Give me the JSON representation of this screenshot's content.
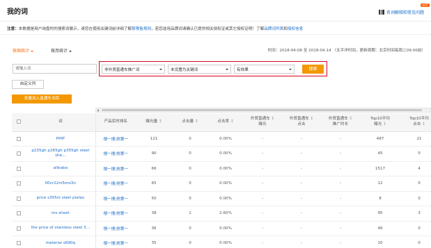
{
  "header": {
    "title": "我的词",
    "help_link": "名词解释和常见问题",
    "hot_badge": "HOT"
  },
  "notice": {
    "label": "注意：",
    "text_before": "本数据是用户询盘时的搜索词展示，请您在使用关键词前详细了解",
    "link_rules": "禁限售规则",
    "text_middle": "，若您选用品牌词请确认已提供相关授权证或其它授权证明！了解",
    "link_brand": "品牌词列表",
    "text_and": "和",
    "link_auth": "授权信息"
  },
  "tabs": {
    "weekly": "按周统计",
    "monthly": "按月统计"
  },
  "time_info": "时间：2018-04-08 至 2018-04-14 （太平洋时间，更新周期：北京时间每周二09:00前）",
  "filters": {
    "keyword_placeholder": "请输入词",
    "select1": "非外贸直通车推广词",
    "select2": "未设置为关键词",
    "select3": "有效果",
    "search_button": "搜索"
  },
  "buttons": {
    "custom_columns": "自定义列",
    "batch_add": "批量加入直通车词库"
  },
  "table": {
    "headers": {
      "keyword": "词",
      "rank": "产品实时排名",
      "impressions": "曝光量",
      "clicks": "点击量",
      "ctr": "点击率",
      "p4p_impressions_line1": "外贸直通车",
      "p4p_impressions_line2": "曝光",
      "p4p_clicks_line1": "外贸直通车",
      "p4p_clicks_line2": "点击",
      "p4p_time_line1": "外贸直通车",
      "p4p_time_line2": "推广时长",
      "top10_imp_line1": "Top10平均",
      "top10_imp_line2": "曝光",
      "top10_clk_line1": "Top10平均",
      "top10_clk_line2": "点击"
    },
    "sort_glyph": "↕",
    "rank_view": "搜一搜",
    "rank_divider": "|",
    "rank_first": "抢第一",
    "rows": [
      {
        "keyword": "ppgi",
        "impressions": "121",
        "clicks": "0",
        "ctr": "0.00%",
        "p4p_imp": "-",
        "p4p_clk": "-",
        "p4p_time": "-",
        "top10_imp": "487",
        "top10_clk": "21"
      },
      {
        "keyword": "p235gh p265gh p355gh steel she...",
        "impressions": "90",
        "clicks": "0",
        "ctr": "0.00%",
        "p4p_imp": "-",
        "p4p_clk": "-",
        "p4p_time": "-",
        "top10_imp": "45",
        "top10_clk": "0"
      },
      {
        "keyword": "alibaba",
        "impressions": "66",
        "clicks": "0",
        "ctr": "0.00%",
        "p4p_imp": "-",
        "p4p_clk": "-",
        "p4p_time": "-",
        "top10_imp": "1517",
        "top10_clk": "4"
      },
      {
        "keyword": "00cr22ni5mo3n",
        "impressions": "65",
        "clicks": "0",
        "ctr": "0.00%",
        "p4p_imp": "-",
        "p4p_clk": "-",
        "p4p_time": "-",
        "top10_imp": "12",
        "top10_clk": "0"
      },
      {
        "keyword": "price s355nl steel plates",
        "impressions": "50",
        "clicks": "0",
        "ctr": "0.00%",
        "p4p_imp": "-",
        "p4p_clk": "-",
        "p4p_time": "-",
        "top10_imp": "8",
        "top10_clk": "0"
      },
      {
        "keyword": "ms sheet",
        "impressions": "38",
        "clicks": "1",
        "ctr": "2.60%",
        "p4p_imp": "-",
        "p4p_clk": "-",
        "p4p_time": "-",
        "top10_imp": "95",
        "top10_clk": "3"
      },
      {
        "keyword": "the price of stainless steel 3...",
        "impressions": "36",
        "clicks": "0",
        "ctr": "0.00%",
        "p4p_imp": "-",
        "p4p_clk": "-",
        "p4p_time": "-",
        "top10_imp": "46",
        "top10_clk": "0"
      },
      {
        "keyword": "material s690q",
        "impressions": "35",
        "clicks": "0",
        "ctr": "0.00%",
        "p4p_imp": "-",
        "p4p_clk": "-",
        "p4p_time": "-",
        "top10_imp": "10",
        "top10_clk": "0"
      }
    ]
  },
  "colors": {
    "accent_orange": "#f39800",
    "link_blue": "#1a6cc7",
    "highlight_red": "#d9001b"
  }
}
